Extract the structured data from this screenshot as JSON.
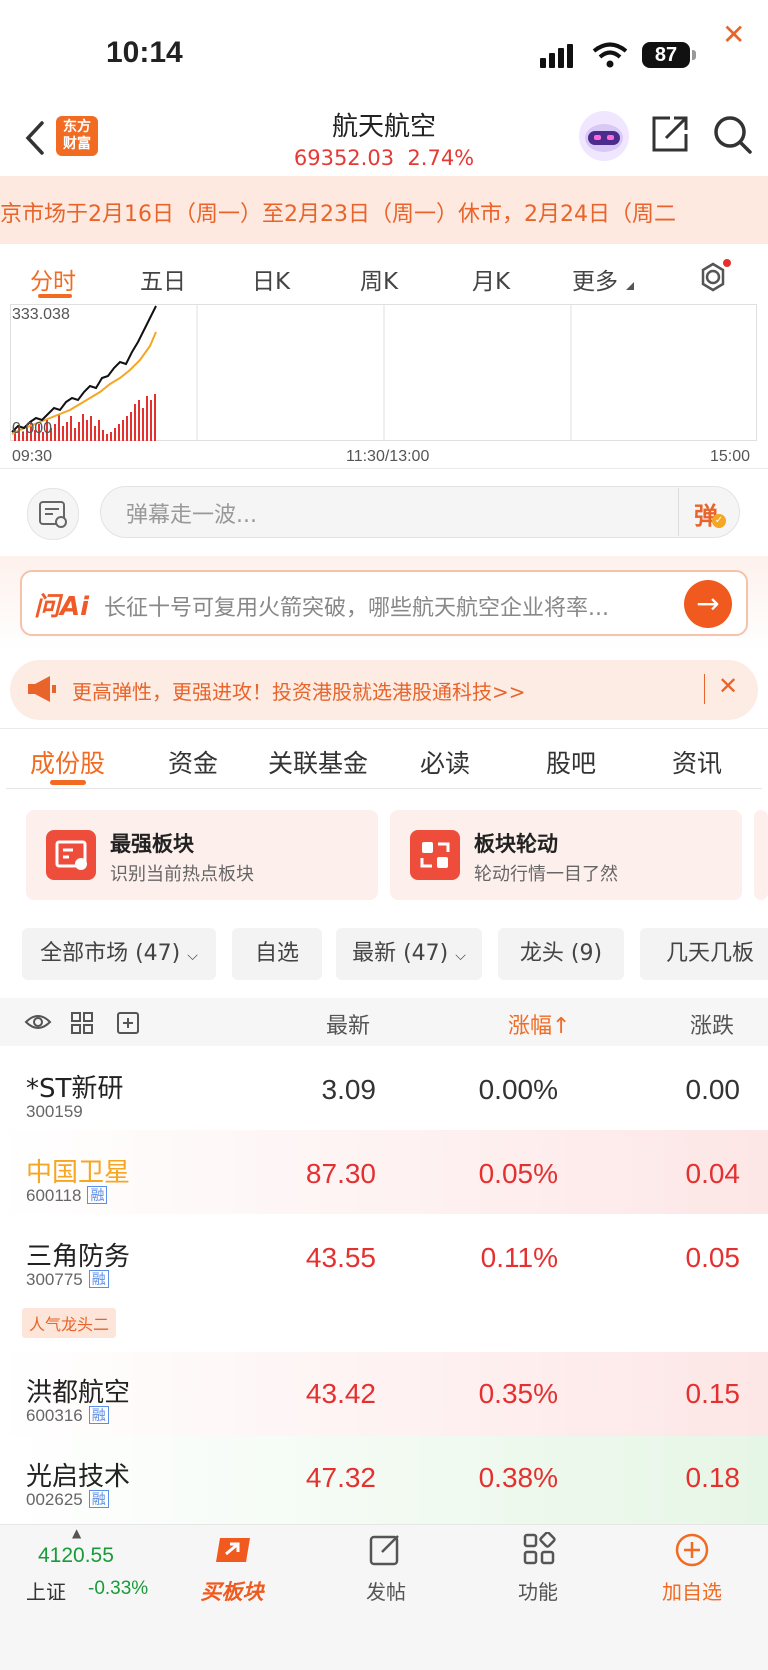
{
  "status_bar": {
    "time": "10:14",
    "battery": "87"
  },
  "header": {
    "logo_line1": "东方",
    "logo_line2": "财富",
    "title": "航天航空",
    "index_value": "69352.03",
    "index_change": "2.74%"
  },
  "notice": {
    "text": "京市场于2月16日（周一）至2月23日（周一）休市，2月24日（周二"
  },
  "chart_tabs": [
    "分时",
    "五日",
    "日K",
    "周K",
    "月K",
    "更多"
  ],
  "chart": {
    "high_label": "333.038",
    "low_label": "0.000",
    "time_start": "09:30",
    "time_mid": "11:30/13:00",
    "time_end": "15:00"
  },
  "danmaku": {
    "placeholder": "弹幕走一波...",
    "button": "弹"
  },
  "ai": {
    "logo": "问Ai",
    "question": "长征十号可复用火箭突破，哪些航天航空企业将率..."
  },
  "promo": {
    "text": "更高弹性，更强进攻！投资港股就选港股通科技>>"
  },
  "section_tabs": [
    "成份股",
    "资金",
    "关联基金",
    "必读",
    "股吧",
    "资讯"
  ],
  "cards": [
    {
      "title": "最强板块",
      "subtitle": "识别当前热点板块"
    },
    {
      "title": "板块轮动",
      "subtitle": "轮动行情一目了然"
    }
  ],
  "filters": [
    "全部市场 (47)",
    "自选",
    "最新 (47)",
    "龙头 (9)",
    "几天几板"
  ],
  "table": {
    "col_latest": "最新",
    "col_change_pct": "涨幅↑",
    "col_change": "涨跌",
    "rows": [
      {
        "name": "*ST新研",
        "code": "300159",
        "rong": "",
        "tag": "",
        "price": "3.09",
        "pct": "0.00%",
        "chg": "0.00"
      },
      {
        "name": "中国卫星",
        "code": "600118",
        "rong": "融",
        "tag": "",
        "price": "87.30",
        "pct": "0.05%",
        "chg": "0.04"
      },
      {
        "name": "三角防务",
        "code": "300775",
        "rong": "融",
        "tag": "人气龙头二",
        "price": "43.55",
        "pct": "0.11%",
        "chg": "0.05"
      },
      {
        "name": "洪都航空",
        "code": "600316",
        "rong": "融",
        "tag": "",
        "price": "43.42",
        "pct": "0.35%",
        "chg": "0.15"
      },
      {
        "name": "光启技术",
        "code": "002625",
        "rong": "融",
        "tag": "",
        "price": "47.32",
        "pct": "0.38%",
        "chg": "0.18"
      }
    ]
  },
  "bottom_bar": {
    "index_value": "4120.55",
    "index_name": "上证",
    "index_change": "-0.33%",
    "buy_label": "买板块",
    "post_label": "发帖",
    "func_label": "功能",
    "add_label": "加自选"
  },
  "colors": {
    "accent": "#f26b22",
    "up": "#e53030",
    "down": "#1a9b3a"
  }
}
